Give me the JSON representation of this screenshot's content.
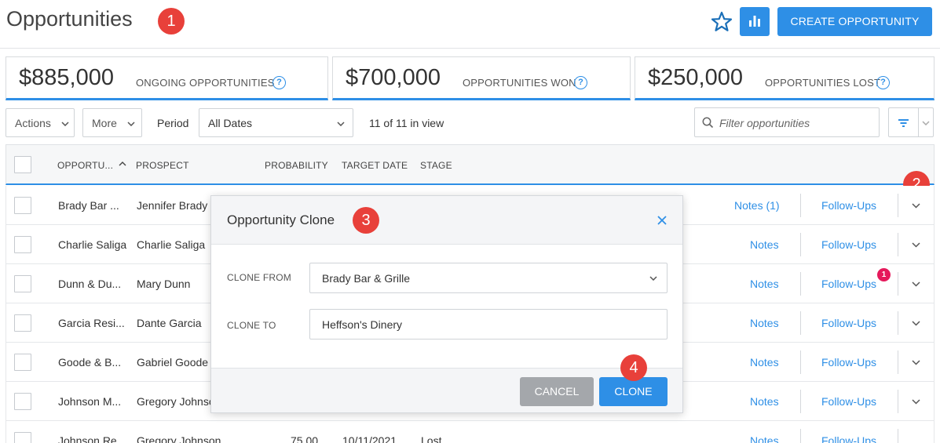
{
  "header": {
    "title": "Opportunities",
    "create_label": "CREATE OPPORTUNITY",
    "star_icon": "star-icon",
    "chart_icon": "bar-chart-icon",
    "accent": "#2e8fe6"
  },
  "callouts": [
    "1",
    "2",
    "3",
    "4"
  ],
  "stats": [
    {
      "amount": "$885,000",
      "label": "ONGOING OPPORTUNITIES"
    },
    {
      "amount": "$700,000",
      "label": "OPPORTUNITIES WON"
    },
    {
      "amount": "$250,000",
      "label": "OPPORTUNITIES LOST"
    }
  ],
  "toolbar": {
    "actions_label": "Actions",
    "more_label": "More",
    "period_label": "Period",
    "period_value": "All Dates",
    "count_text": "11 of 11 in view",
    "filter_placeholder": "Filter opportunities"
  },
  "table": {
    "columns": [
      "OPPORTU...",
      "PROSPECT",
      "PROBABILITY",
      "TARGET DATE",
      "STAGE"
    ],
    "rows": [
      {
        "opportunity": "Brady Bar ...",
        "prospect": "Jennifer Brady",
        "probability": "",
        "target_date": "",
        "stage": "",
        "notes": "Notes (1)",
        "followups": "Follow-Ups",
        "badge": ""
      },
      {
        "opportunity": "Charlie Saliga",
        "prospect": "Charlie Saliga",
        "probability": "",
        "target_date": "",
        "stage": "",
        "notes": "Notes",
        "followups": "Follow-Ups",
        "badge": ""
      },
      {
        "opportunity": "Dunn & Du...",
        "prospect": "Mary Dunn",
        "probability": "",
        "target_date": "",
        "stage": "",
        "notes": "Notes",
        "followups": "Follow-Ups",
        "badge": "1"
      },
      {
        "opportunity": "Garcia Resi...",
        "prospect": "Dante Garcia",
        "probability": "",
        "target_date": "",
        "stage": "",
        "notes": "Notes",
        "followups": "Follow-Ups",
        "badge": ""
      },
      {
        "opportunity": "Goode & B...",
        "prospect": "Gabriel Goode",
        "probability": "",
        "target_date": "",
        "stage": "",
        "notes": "Notes",
        "followups": "Follow-Ups",
        "badge": ""
      },
      {
        "opportunity": "Johnson M...",
        "prospect": "Gregory Johnso",
        "probability": "",
        "target_date": "",
        "stage": "",
        "notes": "Notes",
        "followups": "Follow-Ups",
        "badge": ""
      },
      {
        "opportunity": "Johnson Re...",
        "prospect": "Gregory Johnson",
        "probability": "75.00",
        "target_date": "10/11/2021",
        "stage": "Lost",
        "notes": "Notes",
        "followups": "Follow-Ups",
        "badge": ""
      }
    ]
  },
  "modal": {
    "title": "Opportunity Clone",
    "clone_from_label": "CLONE FROM",
    "clone_from_value": "Brady Bar & Grille",
    "clone_to_label": "CLONE TO",
    "clone_to_value": "Heffson's Dinery",
    "cancel_label": "CANCEL",
    "clone_label": "CLONE"
  }
}
